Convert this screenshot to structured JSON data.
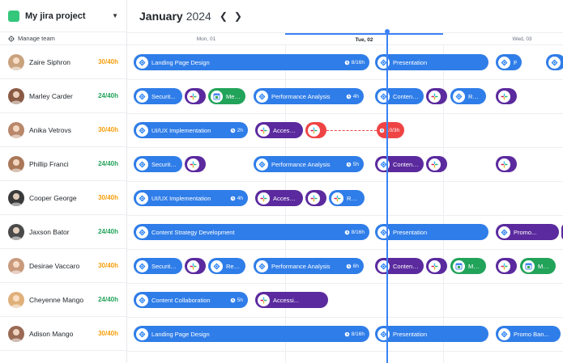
{
  "project": {
    "name": "My jira project"
  },
  "sidebar": {
    "manage_label": "Manage team"
  },
  "calendar": {
    "month": "January",
    "year": "2024",
    "days": [
      "Mon, 01",
      "Tue, 02",
      "Wed, 03"
    ]
  },
  "colors": {
    "blue": "#2f7de8",
    "purple": "#5b2a9e",
    "green": "#22a35a",
    "red": "#ef4444",
    "hours_warn": "#f59e0b",
    "hours_ok": "#22a35a",
    "today": "#3b82f6"
  },
  "members": [
    {
      "name": "Zaire Siphron",
      "hours": "30/40h",
      "status": "warn",
      "avatar_color": "#c9a27e",
      "tasks": [
        {
          "icon": "jira",
          "label": "Landing Page Design",
          "hours": "8/16h",
          "color": "blue"
        },
        {
          "icon": "jira",
          "label": "Presentation",
          "hours": "",
          "color": "blue"
        },
        {
          "icon": "jira",
          "label": "Promo B...",
          "hours": "",
          "color": "blue"
        },
        {
          "icon": "jira",
          "label": "",
          "hours": "",
          "color": "blue"
        }
      ]
    },
    {
      "name": "Marley Carder",
      "hours": "24/40h",
      "status": "ok",
      "avatar_color": "#8a5a44",
      "tasks": [
        {
          "icon": "jira",
          "label": "Securit...",
          "hours": "",
          "color": "blue"
        },
        {
          "icon": "slack",
          "label": "",
          "hours": "",
          "color": "purple"
        },
        {
          "icon": "gcal",
          "label": "Mee...",
          "hours": "",
          "color": "green"
        },
        {
          "icon": "jira",
          "label": "Performance Analysis",
          "hours": "4h",
          "color": "blue"
        },
        {
          "icon": "jira",
          "label": "Content...",
          "hours": "",
          "color": "blue"
        },
        {
          "icon": "slack",
          "label": "",
          "hours": "",
          "color": "purple"
        },
        {
          "icon": "jira",
          "label": "Rev...",
          "hours": "",
          "color": "blue"
        },
        {
          "icon": "slack",
          "label": "",
          "hours": "",
          "color": "purple"
        }
      ]
    },
    {
      "name": "Anika Vetrovs",
      "hours": "30/40h",
      "status": "warn",
      "avatar_color": "#b9876a",
      "tasks": [
        {
          "icon": "jira",
          "label": "UI/UX Implementation",
          "hours": "2h",
          "color": "blue"
        },
        {
          "icon": "slack",
          "label": "Accessi...",
          "hours": "",
          "color": "purple"
        },
        {
          "icon": "slack",
          "label": "",
          "hours": "",
          "color": "red"
        },
        {
          "icon": "",
          "label": "",
          "hours": "10/3h",
          "color": "red"
        }
      ]
    },
    {
      "name": "Phillip Franci",
      "hours": "24/40h",
      "status": "ok",
      "avatar_color": "#a97858",
      "tasks": [
        {
          "icon": "jira",
          "label": "Security Enh...",
          "hours": "",
          "color": "blue"
        },
        {
          "icon": "slack",
          "label": "",
          "hours": "",
          "color": "purple"
        },
        {
          "icon": "jira",
          "label": "Performance Analysis",
          "hours": "5h",
          "color": "blue"
        },
        {
          "icon": "jira",
          "label": "Content...",
          "hours": "",
          "color": "purple"
        },
        {
          "icon": "slack",
          "label": "",
          "hours": "",
          "color": "purple"
        },
        {
          "icon": "slack",
          "label": "",
          "hours": "",
          "color": "purple"
        }
      ]
    },
    {
      "name": "Cooper George",
      "hours": "30/40h",
      "status": "warn",
      "avatar_color": "#3a3a3a",
      "tasks": [
        {
          "icon": "jira",
          "label": "UI/UX Implementation",
          "hours": "4h",
          "color": "blue"
        },
        {
          "icon": "slack",
          "label": "Accessibilit...",
          "hours": "",
          "color": "purple"
        },
        {
          "icon": "slack",
          "label": "",
          "hours": "",
          "color": "purple"
        },
        {
          "icon": "slack",
          "label": "Rev...",
          "hours": "",
          "color": "blue"
        }
      ]
    },
    {
      "name": "Jaxson Bator",
      "hours": "24/40h",
      "status": "ok",
      "avatar_color": "#4a4a4a",
      "tasks": [
        {
          "icon": "jira",
          "label": "Content Strategy Development",
          "hours": "8/16h",
          "color": "blue"
        },
        {
          "icon": "jira",
          "label": "Presentation",
          "hours": "",
          "color": "blue"
        },
        {
          "icon": "jira",
          "label": "Promo...",
          "hours": "",
          "color": "purple"
        },
        {
          "icon": "slack",
          "label": "",
          "hours": "",
          "color": "purple"
        }
      ]
    },
    {
      "name": "Desirae Vaccaro",
      "hours": "30/40h",
      "status": "warn",
      "avatar_color": "#c99a7c",
      "tasks": [
        {
          "icon": "jira",
          "label": "Security...",
          "hours": "",
          "color": "blue"
        },
        {
          "icon": "slack",
          "label": "",
          "hours": "",
          "color": "purple"
        },
        {
          "icon": "jira",
          "label": "Rev...",
          "hours": "",
          "color": "blue"
        },
        {
          "icon": "jira",
          "label": "Performance Analysis",
          "hours": "6h",
          "color": "blue"
        },
        {
          "icon": "jira",
          "label": "Content...",
          "hours": "",
          "color": "purple"
        },
        {
          "icon": "slack",
          "label": "",
          "hours": "",
          "color": "purple"
        },
        {
          "icon": "gcal",
          "label": "Mee...",
          "hours": "",
          "color": "green"
        },
        {
          "icon": "slack",
          "label": "",
          "hours": "",
          "color": "purple"
        },
        {
          "icon": "gcal",
          "label": "Mee...",
          "hours": "",
          "color": "green"
        }
      ]
    },
    {
      "name": "Cheyenne Mango",
      "hours": "24/40h",
      "status": "ok",
      "avatar_color": "#e0b07a",
      "tasks": [
        {
          "icon": "jira",
          "label": "Content Collaboration",
          "hours": "5h",
          "color": "blue"
        },
        {
          "icon": "slack",
          "label": "Accessi...",
          "hours": "",
          "color": "purple"
        }
      ]
    },
    {
      "name": "Adison Mango",
      "hours": "30/40h",
      "status": "warn",
      "avatar_color": "#9a6a55",
      "tasks": [
        {
          "icon": "jira",
          "label": "Landing Page Design",
          "hours": "8/16h",
          "color": "blue"
        },
        {
          "icon": "jira",
          "label": "Presentation",
          "hours": "",
          "color": "blue"
        },
        {
          "icon": "jira",
          "label": "Promo Ban...",
          "hours": "",
          "color": "blue"
        }
      ]
    }
  ]
}
